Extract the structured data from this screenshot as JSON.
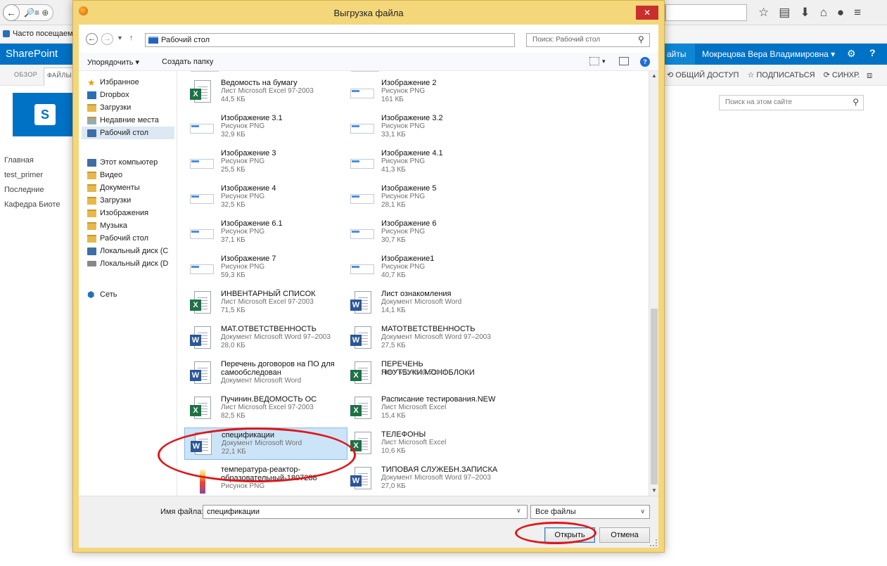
{
  "browser": {
    "bookmark_label": "Часто посещаем",
    "nav_glyph": "🔎≡ ⊕"
  },
  "sharepoint": {
    "brand": "SharePoint",
    "sites_label": "айты",
    "user_name": "Мокрецова Вера Владимировна ▾",
    "ribbon_tabs": [
      "ОБЗОР",
      "ФАЙЛЫ"
    ],
    "actions": [
      "⟲ ОБЩИЙ ДОСТУП",
      "☆ ПОДПИСАТЬСЯ",
      "⟳ СИНХР."
    ],
    "site_search_placeholder": "Поиск на этом сайте",
    "quick_launch": [
      "Главная",
      "test_primer",
      "Последние",
      "Кафедра Биоте"
    ]
  },
  "dialog": {
    "title": "Выгрузка файла",
    "address_path": "Рабочий стол",
    "search_placeholder": "Поиск: Рабочий стол",
    "toolbar": {
      "organize": "Упорядочить ▾",
      "new_folder": "Создать папку"
    },
    "nav_pane": {
      "favorites_header": "Избранное",
      "favorites": [
        "Dropbox",
        "Загрузки",
        "Недавние места",
        "Рабочий стол"
      ],
      "computer_header": "Этот компьютер",
      "computer_items": [
        "Видео",
        "Документы",
        "Загрузки",
        "Изображения",
        "Музыка",
        "Рабочий стол",
        "Локальный диск (C",
        "Локальный диск (D"
      ],
      "network": "Сеть"
    },
    "files": [
      {
        "name": "Ведомость на бумагу",
        "type": "Лист Microsoft Excel 97-2003",
        "size": "44,5 КБ",
        "icon": "excel-icon"
      },
      {
        "name": "Изображение 2",
        "type": "Рисунок PNG",
        "size": "161 КБ",
        "icon": "image-icon"
      },
      {
        "name": "Изображение 3.1",
        "type": "Рисунок PNG",
        "size": "32,9 КБ",
        "icon": "image-icon"
      },
      {
        "name": "Изображение 3.2",
        "type": "Рисунок PNG",
        "size": "33,1 КБ",
        "icon": "image-icon"
      },
      {
        "name": "Изображение 3",
        "type": "Рисунок PNG",
        "size": "25,5 КБ",
        "icon": "image-icon"
      },
      {
        "name": "Изображение 4.1",
        "type": "Рисунок PNG",
        "size": "41,3 КБ",
        "icon": "image-icon"
      },
      {
        "name": "Изображение 4",
        "type": "Рисунок PNG",
        "size": "32,5 КБ",
        "icon": "image-icon"
      },
      {
        "name": "Изображение 5",
        "type": "Рисунок PNG",
        "size": "28,1 КБ",
        "icon": "image-icon"
      },
      {
        "name": "Изображение 6.1",
        "type": "Рисунок PNG",
        "size": "37,1 КБ",
        "icon": "image-icon"
      },
      {
        "name": "Изображение 6",
        "type": "Рисунок PNG",
        "size": "30,7 КБ",
        "icon": "image-icon"
      },
      {
        "name": "Изображение 7",
        "type": "Рисунок PNG",
        "size": "59,3 КБ",
        "icon": "image-icon"
      },
      {
        "name": "Изображение1",
        "type": "Рисунок PNG",
        "size": "40,7 КБ",
        "icon": "image-icon"
      },
      {
        "name": "ИНВЕНТАРНЫЙ СПИСОК",
        "type": "Лист Microsoft Excel 97-2003",
        "size": "71,5 КБ",
        "icon": "excel-icon"
      },
      {
        "name": "Лист ознакомления",
        "type": "Документ Microsoft Word",
        "size": "14,1 КБ",
        "icon": "word-icon"
      },
      {
        "name": "МАТ.ОТВЕТСТВЕННОСТЬ",
        "type": "Документ Microsoft Word 97–2003",
        "size": "28,0 КБ",
        "icon": "word-icon"
      },
      {
        "name": "МАТОТВЕТСТВЕННОСТЬ",
        "type": "Документ Microsoft Word 97–2003",
        "size": "27,5 КБ",
        "icon": "word-icon"
      },
      {
        "name": "Перечень договоров на ПО для самообследован",
        "type": "Документ Microsoft Word",
        "size": "",
        "icon": "word-icon"
      },
      {
        "name": "ПЕРЕЧЕНЬ НОУТБУКИ.МОНОБЛОКИ",
        "type": "Лист Microsoft Excel",
        "size": "",
        "icon": "excel-icon"
      },
      {
        "name": "Пучинин.ВЕДОМОСТЬ ОС",
        "type": "Лист Microsoft Excel 97-2003",
        "size": "82,5 КБ",
        "icon": "excel-icon"
      },
      {
        "name": "Расписание тестирования.NEW",
        "type": "Лист Microsoft Excel",
        "size": "15,4 КБ",
        "icon": "excel-icon"
      },
      {
        "name": "спецификации",
        "type": "Документ Microsoft Word",
        "size": "22,1 КБ",
        "icon": "word-icon"
      },
      {
        "name": "ТЕЛЕФОНЫ",
        "type": "Лист Microsoft Excel",
        "size": "10,6 КБ",
        "icon": "excel-icon"
      },
      {
        "name": "температура-реактор-образовательный-1807288",
        "type": "Рисунок PNG",
        "size": "",
        "icon": "gradient-image-icon"
      },
      {
        "name": "ТИПОВАЯ СЛУЖЕБН.ЗАПИСКА",
        "type": "Документ Microsoft Word 97–2003",
        "size": "27,0 КБ",
        "icon": "word-icon"
      }
    ],
    "filename_label": "Имя файла:",
    "filename_value": "спецификации",
    "filter": "Все файлы",
    "open_button": "Открыть",
    "cancel_button": "Отмена"
  },
  "colors": {
    "dialog_frame": "#f4d77a",
    "sharepoint_blue": "#0072c6",
    "selection": "#cce4f7",
    "annotation_red": "#e0161a"
  }
}
